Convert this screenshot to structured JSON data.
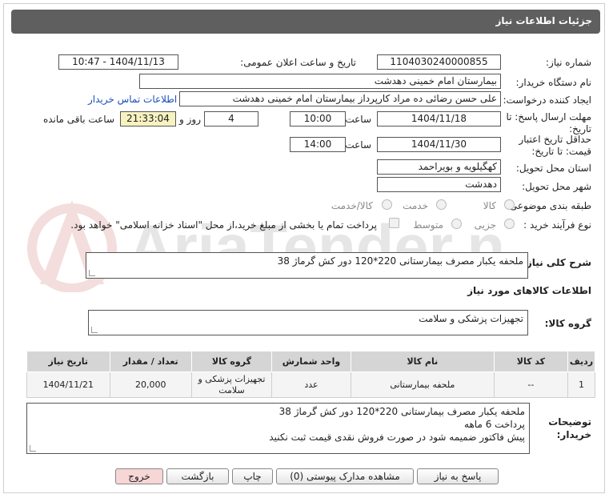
{
  "header": {
    "title": "جزئیات اطلاعات نیاز"
  },
  "fields": {
    "need_number_label": "شماره نیاز:",
    "need_number": "1104030240000855",
    "announce_label": "تاریخ و ساعت اعلان عمومی:",
    "announce_value": "1404/11/13 - 10:47",
    "buyer_org_label": "نام دستگاه خریدار:",
    "buyer_org": "بیمارستان امام خمینی دهدشت",
    "creator_label": "ایجاد کننده درخواست:",
    "creator": "علی حسن رضائی ده مراد کارپرداز بیمارستان امام خمینی دهدشت",
    "contact_link": "اطلاعات تماس خریدار",
    "deadline_label_1": "مهلت ارسال پاسخ: تا",
    "deadline_label_2": "تاریخ:",
    "deadline_date": "1404/11/18",
    "time_label": "ساعت",
    "deadline_time": "10:00",
    "days_value": "4",
    "days_label": "روز و",
    "remaining_time": "21:33:04",
    "remaining_label": "ساعت باقی مانده",
    "validity_label_1": "حداقل تاریخ اعتبار",
    "validity_label_2": "قیمت: تا تاریخ:",
    "validity_date": "1404/11/30",
    "validity_time": "14:00",
    "province_label": "استان محل تحویل:",
    "province": "کهگیلویه و بویراحمد",
    "city_label": "شهر محل تحویل:",
    "city": "دهدشت",
    "category_label": "طبقه بندی موضوعی:",
    "category_options": [
      "کالا",
      "خدمت",
      "کالا/خدمت"
    ],
    "process_label": "نوع فرآیند خرید :",
    "process_options": [
      "جزیی",
      "متوسط"
    ],
    "process_note": "پرداخت تمام یا بخشی از مبلغ خرید،از محل \"اسناد خزانه اسلامی\" خواهد بود."
  },
  "description": {
    "label": "شرح کلی نیاز:",
    "value": "ملحفه یکبار مصرف بیمارستانی 220*120 دور کش گرماژ 38"
  },
  "goods_section_title": "اطلاعات کالاهای مورد نیاز",
  "goods_group": {
    "label": "گروه کالا:",
    "value": "تجهیزات پزشکی و سلامت"
  },
  "table": {
    "headers": [
      "ردیف",
      "کد کالا",
      "نام کالا",
      "واحد شمارش",
      "گروه کالا",
      "تعداد / مقدار",
      "تاریخ نیاز"
    ],
    "rows": [
      [
        "1",
        "--",
        "ملحفه بیمارستانی",
        "عدد",
        "تجهیزات پزشکی و سلامت",
        "20,000",
        "1404/11/21"
      ]
    ]
  },
  "buyer_notes": {
    "label_1": "توضیحات",
    "label_2": "خریدار:",
    "lines": [
      "ملحفه یکبار مصرف بیمارستانی 220*120 دور کش گرماژ 38",
      "پرداخت 6 ماهه",
      "پیش فاکتور ضمیمه شود در صورت فروش نقدی قیمت ثبت نکنید"
    ]
  },
  "buttons": {
    "reply": "پاسخ به نیاز",
    "attachments": "مشاهده مدارک پیوستی (0)",
    "print": "چاپ",
    "back": "بازگشت",
    "exit": "خروج"
  },
  "watermark_text": "AriaTender.net",
  "colors": {
    "header_bg": "#5f5f5f",
    "link": "#1a4fb8",
    "remaining_bg": "#f7f2c0",
    "exit_bg": "#f7d6d6"
  }
}
